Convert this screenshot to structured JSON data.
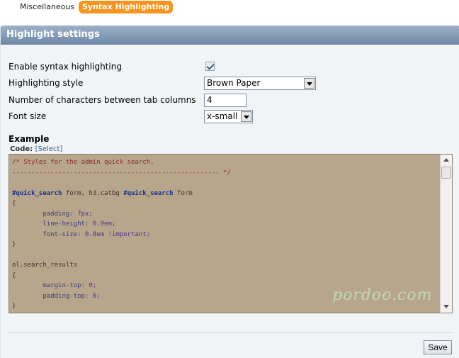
{
  "tabs": [
    {
      "label": "Miscellaneous",
      "active": false
    },
    {
      "label": "Syntax Highlighting",
      "active": true
    }
  ],
  "panel": {
    "title": "Highlight settings"
  },
  "settings": {
    "enable_label": "Enable syntax highlighting",
    "enable_checked": true,
    "style_label": "Highlighting style",
    "style_value": "Brown Paper",
    "tab_label": "Number of characters between tab columns",
    "tab_value": "4",
    "font_label": "Font size",
    "font_value": "x-small"
  },
  "example": {
    "title": "Example",
    "code_label": "Code:",
    "select_link": "[Select]",
    "lines": [
      {
        "kind": "comment",
        "text": "/* Styles for the admin quick search."
      },
      {
        "kind": "comment",
        "text": "------------------------------------------------------ */"
      },
      {
        "kind": "blank",
        "text": ""
      },
      {
        "kind": "mixed",
        "parts": [
          [
            "selector",
            "#quick_search"
          ],
          [
            "plain",
            " form, h3.catbg "
          ],
          [
            "selector",
            "#quick_search"
          ],
          [
            "plain",
            " form"
          ]
        ]
      },
      {
        "kind": "plain",
        "text": "{"
      },
      {
        "kind": "mixed",
        "parts": [
          [
            "prop",
            "        padding: "
          ],
          [
            "value",
            "7px;"
          ]
        ]
      },
      {
        "kind": "mixed",
        "parts": [
          [
            "prop",
            "        line-height: "
          ],
          [
            "value",
            "0.9em;"
          ]
        ]
      },
      {
        "kind": "mixed",
        "parts": [
          [
            "prop",
            "        font-size: "
          ],
          [
            "value",
            "0.8em !important;"
          ]
        ]
      },
      {
        "kind": "plain",
        "text": "}"
      },
      {
        "kind": "blank",
        "text": ""
      },
      {
        "kind": "plain",
        "text": "ol.search_results"
      },
      {
        "kind": "plain",
        "text": "{"
      },
      {
        "kind": "mixed",
        "parts": [
          [
            "prop",
            "        margin-top: "
          ],
          [
            "value",
            "0;"
          ]
        ]
      },
      {
        "kind": "mixed",
        "parts": [
          [
            "prop",
            "        padding-top: "
          ],
          [
            "value",
            "0;"
          ]
        ]
      },
      {
        "kind": "plain",
        "text": "}"
      }
    ],
    "watermark": "pordoo.com"
  },
  "actions": {
    "save_label": "Save"
  },
  "colors": {
    "accent_tab": "#f7941d",
    "header": "#7c94b0",
    "code_bg": "#b7a68b"
  }
}
